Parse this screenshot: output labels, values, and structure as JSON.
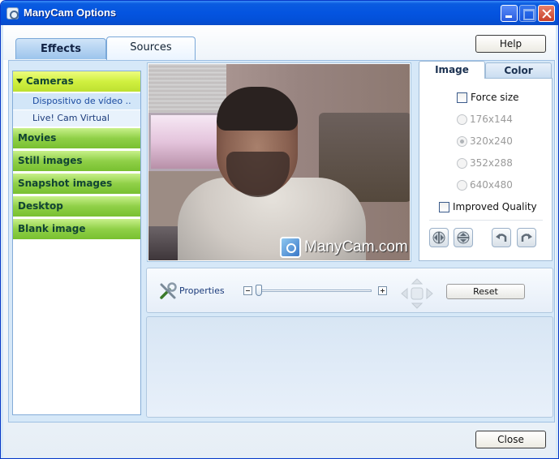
{
  "window": {
    "title": "ManyCam Options",
    "icon": "webcam-icon"
  },
  "tabs": [
    {
      "label": "Effects",
      "active": false
    },
    {
      "label": "Sources",
      "active": true
    }
  ],
  "help_label": "Help",
  "sidebar": {
    "categories": [
      {
        "label": "Cameras",
        "expanded": true
      },
      {
        "label": "Movies"
      },
      {
        "label": "Still images"
      },
      {
        "label": "Snapshot images"
      },
      {
        "label": "Desktop"
      },
      {
        "label": "Blank image"
      }
    ],
    "camera_sources": [
      {
        "label": "Dispositivo de vídeo ..",
        "selected": true
      },
      {
        "label": "Live! Cam Virtual",
        "selected": false
      }
    ]
  },
  "preview": {
    "watermark": "ManyCam.com"
  },
  "image_options": {
    "tabs": [
      {
        "label": "Image",
        "active": true
      },
      {
        "label": "Color",
        "active": false
      }
    ],
    "force_size": {
      "label": "Force size",
      "checked": false
    },
    "resolutions": [
      {
        "label": "176x144",
        "selected": false
      },
      {
        "label": "320x240",
        "selected": true
      },
      {
        "label": "352x288",
        "selected": false
      },
      {
        "label": "640x480",
        "selected": false
      }
    ],
    "improved_quality": {
      "label": "Improved Quality",
      "checked": false
    }
  },
  "properties": {
    "label": "Properties",
    "zoom_level": 0,
    "reset_label": "Reset"
  },
  "close_label": "Close",
  "colors": {
    "titlebar": "#0454e0",
    "accent_green": "#90d048",
    "accent_yellow": "#d0f040",
    "panel_bg": "#d6e8f8"
  }
}
